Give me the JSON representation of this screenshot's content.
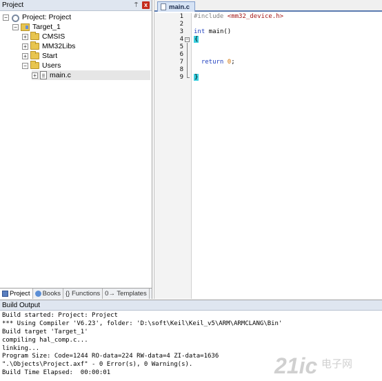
{
  "project_panel": {
    "title": "Project",
    "pin_label": "⍑",
    "close_label": "x",
    "tree": [
      {
        "label": "Project: Project",
        "expander": "−",
        "icon": "project-icon"
      },
      {
        "label": "Target_1",
        "expander": "−",
        "icon": "target-icon"
      },
      {
        "label": "CMSIS",
        "expander": "+",
        "icon": "folder-icon"
      },
      {
        "label": "MM32Libs",
        "expander": "+",
        "icon": "folder-icon"
      },
      {
        "label": "Start",
        "expander": "+",
        "icon": "folder-icon"
      },
      {
        "label": "Users",
        "expander": "−",
        "icon": "folder-open-icon"
      },
      {
        "label": "main.c",
        "expander": "+",
        "icon": "file-icon"
      }
    ],
    "tabs": [
      {
        "label": "Project",
        "icon": "project-tab-icon"
      },
      {
        "label": "Books",
        "icon": "books-icon"
      },
      {
        "label": "{} Functions",
        "icon": "functions-icon"
      },
      {
        "label": "0→ Templates",
        "icon": "templates-icon"
      }
    ]
  },
  "editor": {
    "tab_label": "main.c",
    "lines": [
      {
        "n": "1",
        "segments": [
          {
            "t": "#include ",
            "c": "kw-include"
          },
          {
            "t": "<mm32_device.h>",
            "c": "kw-header"
          }
        ]
      },
      {
        "n": "2",
        "segments": []
      },
      {
        "n": "3",
        "segments": [
          {
            "t": "int",
            "c": "kw-type"
          },
          {
            "t": " main()",
            "c": "kw-plain"
          }
        ]
      },
      {
        "n": "4",
        "segments": [
          {
            "t": "{",
            "c": "brace-hl"
          }
        ]
      },
      {
        "n": "5",
        "segments": []
      },
      {
        "n": "6",
        "segments": []
      },
      {
        "n": "7",
        "segments": [
          {
            "t": "  ",
            "c": "kw-plain"
          },
          {
            "t": "return",
            "c": "kw-type"
          },
          {
            "t": " ",
            "c": "kw-plain"
          },
          {
            "t": "0",
            "c": "kw-num"
          },
          {
            "t": ";",
            "c": "kw-plain"
          }
        ]
      },
      {
        "n": "8",
        "segments": []
      },
      {
        "n": "9",
        "segments": [
          {
            "t": "}",
            "c": "brace-hl"
          }
        ]
      }
    ]
  },
  "build_output": {
    "title": "Build Output",
    "lines": [
      "Build started: Project: Project",
      "*** Using Compiler 'V6.23', folder: 'D:\\soft\\Keil\\Keil_v5\\ARM\\ARMCLANG\\Bin'",
      "Build target 'Target_1'",
      "compiling hal_comp.c...",
      "linking...",
      "Program Size: Code=1244 RO-data=224 RW-data=4 ZI-data=1636",
      "\".\\Objects\\Project.axf\" - 0 Error(s), 0 Warning(s).",
      "Build Time Elapsed:  00:00:01"
    ]
  },
  "watermark": {
    "text": "21ic",
    "subtext": "电子网",
    "color": "#c8c8c8"
  }
}
